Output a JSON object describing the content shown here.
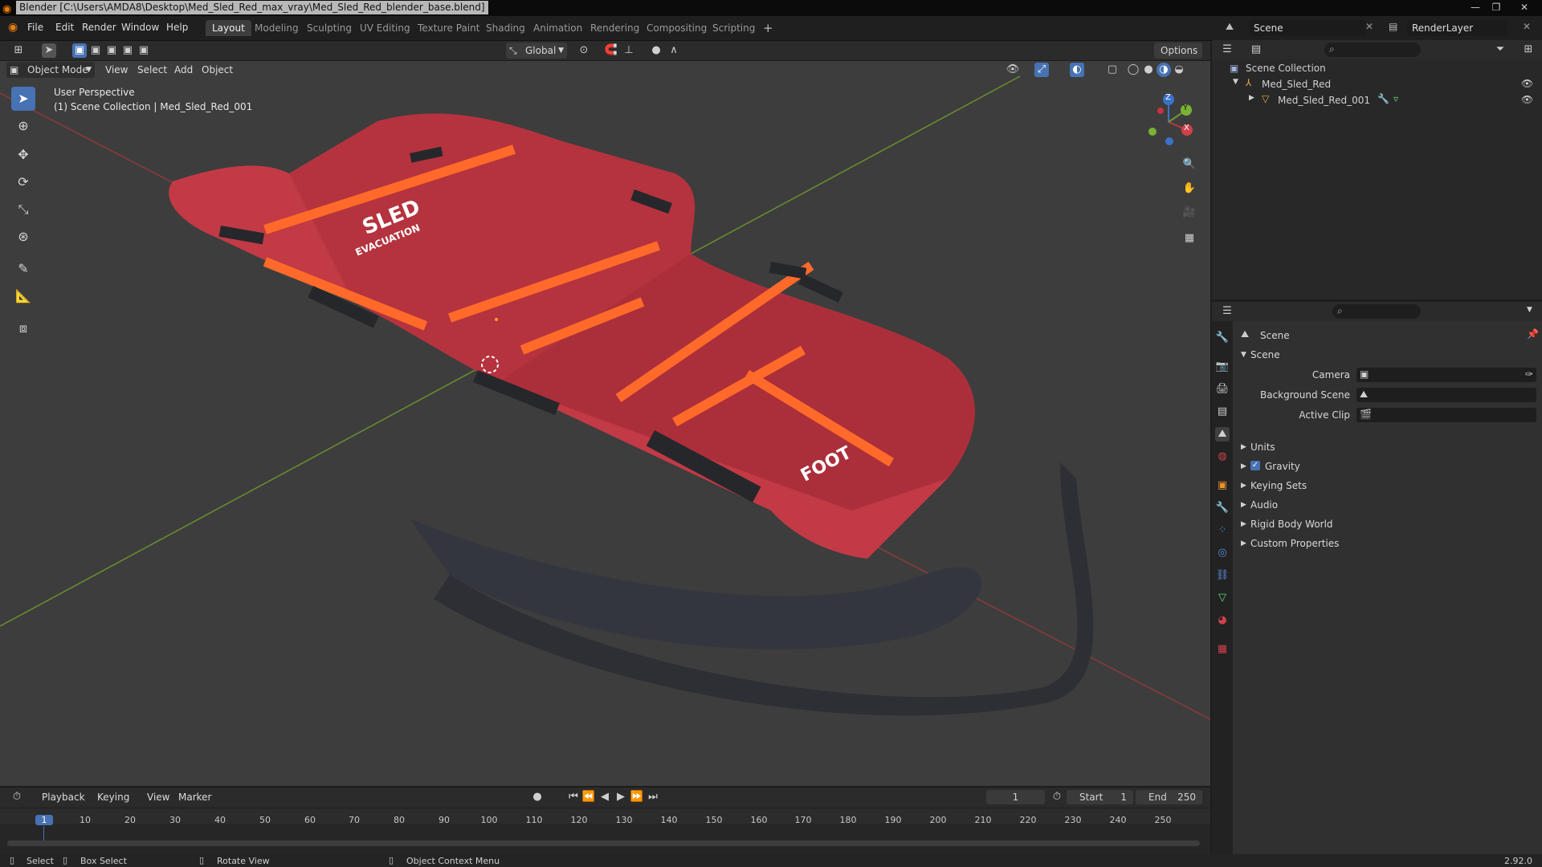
{
  "window": {
    "title": "Blender [C:\\Users\\AMDA8\\Desktop\\Med_Sled_Red_max_vray\\Med_Sled_Red_blender_base.blend]",
    "controls": [
      "—",
      "❐",
      "✕"
    ]
  },
  "menu": [
    "File",
    "Edit",
    "Render",
    "Window",
    "Help"
  ],
  "workspaces": [
    "Layout",
    "Modeling",
    "Sculpting",
    "UV Editing",
    "Texture Paint",
    "Shading",
    "Animation",
    "Rendering",
    "Compositing",
    "Scripting"
  ],
  "active_workspace": "Layout",
  "add_workspace": "+",
  "scene_selector": {
    "scene": "Scene",
    "render_layer": "RenderLayer"
  },
  "viewport_header": {
    "transform_orientation": "Global",
    "options": "Options",
    "mode": "Object Mode",
    "menus": [
      "View",
      "Select",
      "Add",
      "Object"
    ]
  },
  "viewport_overlay": {
    "perspective": "User Perspective",
    "collection": "(1) Scene Collection | Med_Sled_Red_001"
  },
  "sled_texts": {
    "logo": "SLED",
    "sub": "EVACUATION",
    "foot": "FOOT"
  },
  "gizmo": {
    "x": "X",
    "y": "Y",
    "z": "Z"
  },
  "outliner": {
    "root": "Scene Collection",
    "items": [
      {
        "label": "Med_Sled_Red"
      },
      {
        "label": "Med_Sled_Red_001"
      }
    ]
  },
  "properties": {
    "header": "Scene",
    "panel": "Scene",
    "fields": [
      {
        "label": "Camera",
        "value": ""
      },
      {
        "label": "Background Scene",
        "value": ""
      },
      {
        "label": "Active Clip",
        "value": ""
      }
    ],
    "sections": [
      "Units",
      "Gravity",
      "Keying Sets",
      "Audio",
      "Rigid Body World",
      "Custom Properties"
    ],
    "gravity_checked": true
  },
  "timeline": {
    "menus": [
      "Playback",
      "Keying",
      "View",
      "Marker"
    ],
    "current_frame": "1",
    "start_label": "Start",
    "start": "1",
    "end_label": "End",
    "end": "250",
    "ticks": [
      "1",
      "10",
      "20",
      "30",
      "40",
      "50",
      "60",
      "70",
      "80",
      "90",
      "100",
      "110",
      "120",
      "130",
      "140",
      "150",
      "160",
      "170",
      "180",
      "190",
      "200",
      "210",
      "220",
      "230",
      "240",
      "250"
    ]
  },
  "statusbar": {
    "select": "Select",
    "box_select": "Box Select",
    "rotate": "Rotate View",
    "context": "Object Context Menu",
    "version": "2.92.0"
  },
  "colors": {
    "accent": "#4772b3",
    "sled": "#c23a45",
    "strap": "#ff6a2a",
    "grid_x": "#8b3b3b",
    "grid_y": "#6a8e2f"
  }
}
